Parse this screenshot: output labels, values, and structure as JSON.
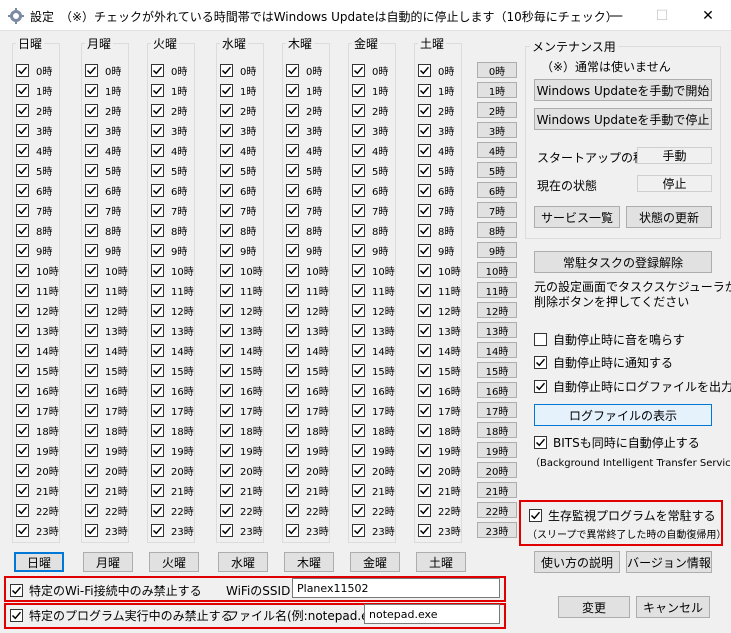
{
  "window": {
    "title": "設定　（※）チェックが外れている時間帯ではWindows Updateは自動的に停止します（10秒毎にチェック）",
    "minimize_glyph": "—",
    "maximize_glyph": "☐",
    "close_glyph": "✕"
  },
  "days": [
    {
      "label": "日曜",
      "button": "日曜"
    },
    {
      "label": "月曜",
      "button": "月曜"
    },
    {
      "label": "火曜",
      "button": "火曜"
    },
    {
      "label": "水曜",
      "button": "水曜"
    },
    {
      "label": "木曜",
      "button": "木曜"
    },
    {
      "label": "金曜",
      "button": "金曜"
    },
    {
      "label": "土曜",
      "button": "土曜"
    }
  ],
  "hours": [
    "0時",
    "1時",
    "2時",
    "3時",
    "4時",
    "5時",
    "6時",
    "7時",
    "8時",
    "9時",
    "10時",
    "11時",
    "12時",
    "13時",
    "14時",
    "15時",
    "16時",
    "17時",
    "18時",
    "19時",
    "20時",
    "21時",
    "22時",
    "23時"
  ],
  "hour_buttons": [
    "0時",
    "1時",
    "2時",
    "3時",
    "4時",
    "5時",
    "6時",
    "7時",
    "8時",
    "9時",
    "10時",
    "11時",
    "12時",
    "13時",
    "14時",
    "15時",
    "16時",
    "17時",
    "18時",
    "19時",
    "20時",
    "21時",
    "22時",
    "23時"
  ],
  "maintenance": {
    "group_label": "メンテナンス用",
    "note": "（※）通常は使いません",
    "start_button": "Windows Updateを手動で開始",
    "stop_button": "Windows Updateを手動で停止",
    "startup_label": "スタートアップの種類",
    "startup_value": "手動",
    "status_label": "現在の状態",
    "status_value": "停止",
    "services_button": "サービス一覧",
    "refresh_button": "状態の更新"
  },
  "task": {
    "unregister_button": "常駐タスクの登録解除",
    "note_line1": "元の設定画面でタスクスケジューラから",
    "note_line2": "削除ボタンを押してください"
  },
  "options": {
    "sound": {
      "label": "自動停止時に音を鳴らす",
      "checked": false
    },
    "notify": {
      "label": "自動停止時に通知する",
      "checked": true
    },
    "log": {
      "label": "自動停止時にログファイルを出力",
      "checked": true
    },
    "log_button": "ログファイルの表示",
    "bits": {
      "label": "BITSも同時に自動停止する",
      "checked": true
    },
    "bits_note": "（Background Intelligent Transfer Service）",
    "watchdog": {
      "label": "生存監視プログラムを常駐する",
      "checked": true
    },
    "watchdog_note": "（スリープで異常終了した時の自動復帰用）"
  },
  "wifi": {
    "label": "特定のWi-Fi接続中のみ禁止する",
    "checked": true,
    "ssid_label": "WiFiのSSID",
    "ssid_value": "Planex11502"
  },
  "program": {
    "label": "特定のプログラム実行中のみ禁止する",
    "checked": true,
    "file_label": "ファイル名(例:notepad.exe)",
    "file_value": "notepad.exe"
  },
  "footer": {
    "help_button": "使い方の説明",
    "version_button": "バージョン情報",
    "ok_button": "変更",
    "cancel_button": "キャンセル"
  },
  "colors": {
    "highlight": "#e00000",
    "accent": "#0078d7"
  }
}
